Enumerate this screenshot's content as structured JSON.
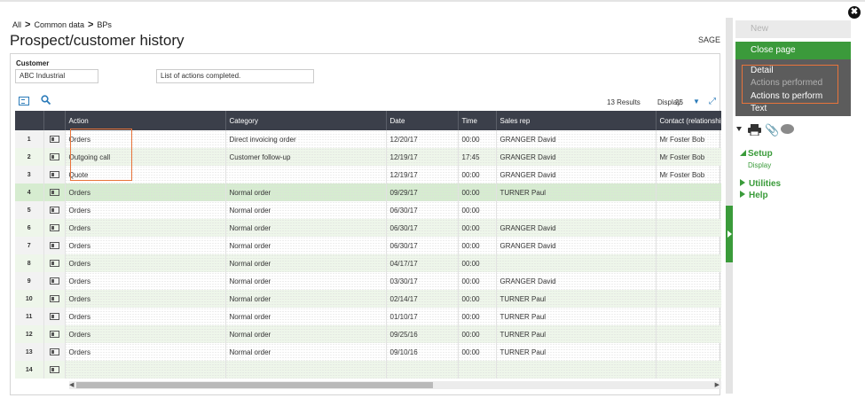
{
  "breadcrumb": {
    "item1": "All",
    "item2": "Common data",
    "item3": "BPs"
  },
  "page": {
    "title": "Prospect/customer history",
    "folder": "SAGE"
  },
  "customer": {
    "label": "Customer",
    "value": "ABC Industrial",
    "list_title": "List of actions completed."
  },
  "toolbar": {
    "results": "13 Results",
    "display_label": "Display:",
    "display_value": "25"
  },
  "table": {
    "columns": [
      "Action",
      "Category",
      "Date",
      "Time",
      "Sales rep",
      "Contact (relationship)"
    ],
    "rows": [
      {
        "num": "1",
        "action": "Orders",
        "category": "Direct invoicing order",
        "date": "12/20/17",
        "time": "00:00",
        "rep": "GRANGER David",
        "contact": "Mr Foster Bob"
      },
      {
        "num": "2",
        "action": "Outgoing call",
        "category": "Customer follow-up",
        "date": "12/19/17",
        "time": "17:45",
        "rep": "GRANGER David",
        "contact": "Mr Foster Bob"
      },
      {
        "num": "3",
        "action": "Quote",
        "category": "",
        "date": "12/19/17",
        "time": "00:00",
        "rep": "GRANGER David",
        "contact": "Mr Foster Bob"
      },
      {
        "num": "4",
        "action": "Orders",
        "category": "Normal order",
        "date": "09/29/17",
        "time": "00:00",
        "rep": "TURNER Paul",
        "contact": ""
      },
      {
        "num": "5",
        "action": "Orders",
        "category": "Normal order",
        "date": "06/30/17",
        "time": "00:00",
        "rep": "",
        "contact": ""
      },
      {
        "num": "6",
        "action": "Orders",
        "category": "Normal order",
        "date": "06/30/17",
        "time": "00:00",
        "rep": "GRANGER David",
        "contact": ""
      },
      {
        "num": "7",
        "action": "Orders",
        "category": "Normal order",
        "date": "06/30/17",
        "time": "00:00",
        "rep": "GRANGER David",
        "contact": ""
      },
      {
        "num": "8",
        "action": "Orders",
        "category": "Normal order",
        "date": "04/17/17",
        "time": "00:00",
        "rep": "",
        "contact": ""
      },
      {
        "num": "9",
        "action": "Orders",
        "category": "Normal order",
        "date": "03/30/17",
        "time": "00:00",
        "rep": "GRANGER David",
        "contact": ""
      },
      {
        "num": "10",
        "action": "Orders",
        "category": "Normal order",
        "date": "02/14/17",
        "time": "00:00",
        "rep": "TURNER Paul",
        "contact": ""
      },
      {
        "num": "11",
        "action": "Orders",
        "category": "Normal order",
        "date": "01/10/17",
        "time": "00:00",
        "rep": "TURNER Paul",
        "contact": ""
      },
      {
        "num": "12",
        "action": "Orders",
        "category": "Normal order",
        "date": "09/25/16",
        "time": "00:00",
        "rep": "TURNER Paul",
        "contact": ""
      },
      {
        "num": "13",
        "action": "Orders",
        "category": "Normal order",
        "date": "09/10/16",
        "time": "00:00",
        "rep": "TURNER Paul",
        "contact": ""
      },
      {
        "num": "14",
        "action": "",
        "category": "",
        "date": "",
        "time": "",
        "rep": "",
        "contact": ""
      }
    ]
  },
  "sidebar": {
    "new": "New",
    "close": "Close page",
    "menu": [
      "Detail",
      "Actions performed",
      "Actions to perform",
      "Text"
    ],
    "setup": "Setup",
    "display": "Display",
    "utilities": "Utilities",
    "help": "Help"
  },
  "colors": {
    "accent_green": "#3a9b3a",
    "header_dark": "#3b3f4a",
    "highlight_orange": "#e8743b"
  }
}
